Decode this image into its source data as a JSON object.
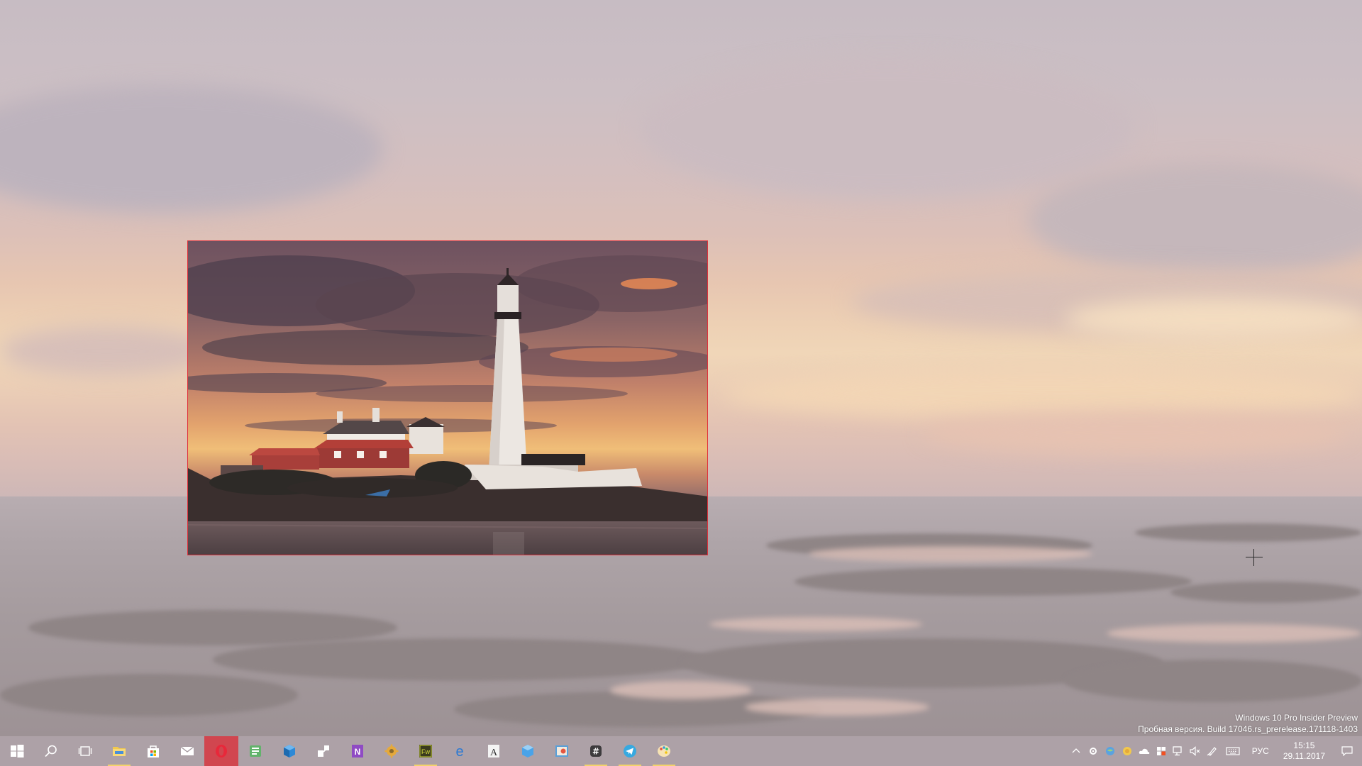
{
  "desktop": {
    "wallpaper": "lighthouse-sunset",
    "selection_color": "#e0303a"
  },
  "watermark": {
    "line1": "Windows 10 Pro Insider Preview",
    "line2": "Пробная версия. Build 17046.rs_prerelease.171118-1403"
  },
  "taskbar": {
    "apps": [
      {
        "name": "start",
        "icon": "windows-logo-icon"
      },
      {
        "name": "search",
        "icon": "search-icon"
      },
      {
        "name": "task-view",
        "icon": "task-view-icon"
      },
      {
        "name": "file-explorer",
        "icon": "folder-icon",
        "running": true
      },
      {
        "name": "store",
        "icon": "store-bag-icon"
      },
      {
        "name": "mail",
        "icon": "mail-icon"
      },
      {
        "name": "opera",
        "icon": "opera-icon",
        "active": true
      },
      {
        "name": "feed-reader",
        "icon": "feed-icon"
      },
      {
        "name": "cube-app",
        "icon": "cube-icon"
      },
      {
        "name": "connect-app",
        "icon": "connect-icon"
      },
      {
        "name": "onenote",
        "icon": "onenote-icon",
        "text": "N"
      },
      {
        "name": "gear-app",
        "icon": "gear-icon"
      },
      {
        "name": "fireworks",
        "icon": "fireworks-icon",
        "text": "Fw",
        "running": true
      },
      {
        "name": "edge",
        "icon": "edge-icon",
        "text": "e"
      },
      {
        "name": "font-app",
        "icon": "font-icon",
        "text": "A"
      },
      {
        "name": "cube-app-2",
        "icon": "cube2-icon"
      },
      {
        "name": "snip-app",
        "icon": "snip-icon"
      },
      {
        "name": "slack",
        "icon": "slack-icon",
        "running": true
      },
      {
        "name": "telegram",
        "icon": "telegram-icon",
        "running": true
      },
      {
        "name": "paint",
        "icon": "palette-icon",
        "running": true
      }
    ],
    "tray": {
      "icons": [
        "chevron-up-icon",
        "settings-icon",
        "globe-icon",
        "coin-icon",
        "cloud-icon",
        "flag-icon",
        "network-icon",
        "volume-muted-icon",
        "pen-icon",
        "keyboard-icon"
      ],
      "language": "РУС",
      "time": "15:15",
      "date": "29.11.2017"
    }
  }
}
